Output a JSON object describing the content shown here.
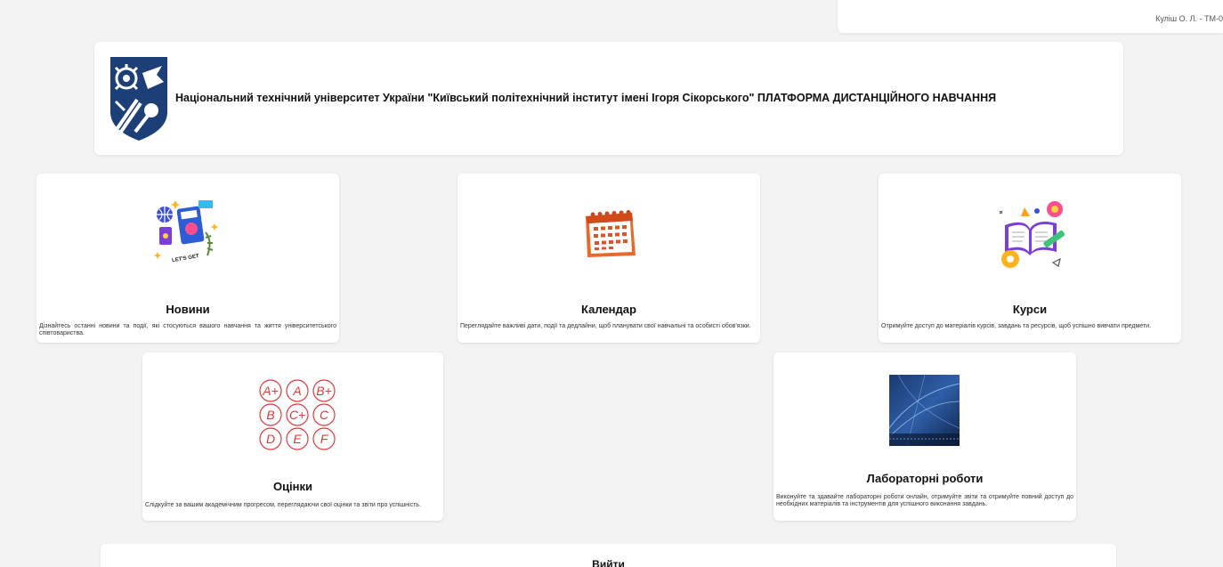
{
  "user": {
    "name": "Куліш О. Л. - ТМ-0"
  },
  "header": {
    "title": "Національний технічний університет України \"Київський політехнічний інститут імені Ігоря Сікорського\" ПЛАТФОРМА ДИСТАНЦІЙНОГО НАВЧАННЯ"
  },
  "cards": {
    "news": {
      "title": "Новини",
      "description": "Дізнайтесь останні новини та події, які стосуються вашого навчання та життя університетського співтовариства.",
      "icon": "news-illustration"
    },
    "calendar": {
      "title": "Календар",
      "description": "Переглядайте важливі дати, події та дедлайни, щоб планувати свої навчальні та особисті обов'язки.",
      "icon": "calendar-illustration"
    },
    "courses": {
      "title": "Курси",
      "description": "Отримуйте доступ до матеріалів курсів, завдань та ресурсів, щоб успішно вивчати предмети.",
      "icon": "courses-illustration"
    },
    "grades": {
      "title": "Оцінки",
      "description": "Слідкуйте за вашим академічним прогресом, переглядаючи свої оцінки та звіти про успішність.",
      "icon": "grades-illustration",
      "letters": [
        "A+",
        "A",
        "B+",
        "B",
        "C+",
        "C",
        "D",
        "E",
        "F"
      ]
    },
    "labs": {
      "title": "Лабораторні роботи",
      "description": "Виконуйте та здавайте лабораторні роботи онлайн, отримуйте звіти та отримуйте повний доступ до необхідних матеріалів та інструментів для успішного виконання завдань.",
      "icon": "labs-image"
    }
  },
  "logout": {
    "label": "Вийти"
  },
  "colors": {
    "page_bg": "#f3f3f3",
    "card_bg": "#ffffff",
    "logo_blue": "#1d3f77",
    "grade_red": "#e03a3a"
  }
}
